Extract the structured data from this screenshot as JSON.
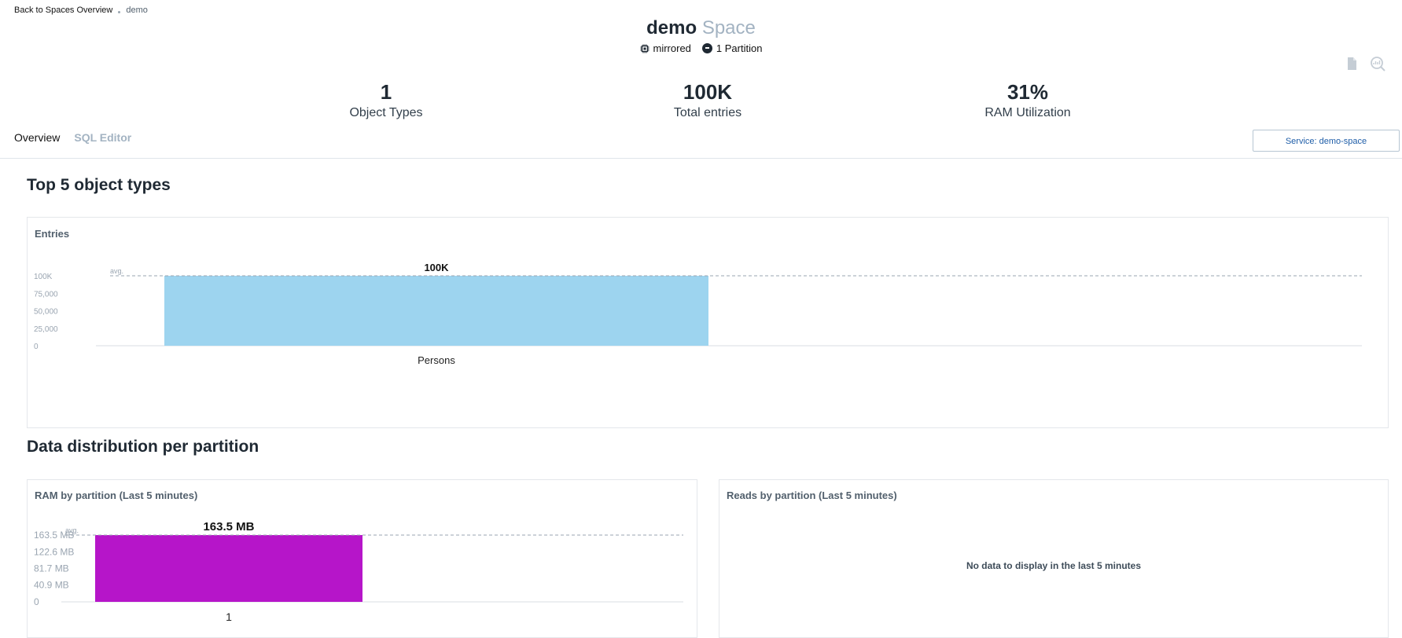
{
  "breadcrumb": {
    "back": "Back to Spaces Overview",
    "current": "demo"
  },
  "header": {
    "space_name": "demo",
    "space_suffix": "Space",
    "badges": {
      "mode": "mirrored",
      "partitions": "1 Partition"
    },
    "icons": [
      "document-icon",
      "monitor-search-icon"
    ]
  },
  "stats": [
    {
      "value": "1",
      "label": "Object Types"
    },
    {
      "value": "100K",
      "label": "Total entries"
    },
    {
      "value": "31%",
      "label": "RAM Utilization"
    }
  ],
  "tabs": [
    {
      "label": "Overview",
      "active": true
    },
    {
      "label": "SQL Editor",
      "active": false
    }
  ],
  "service_button": "Service: demo-space",
  "sections": {
    "top_types": "Top 5 object types",
    "distribution": "Data distribution per partition"
  },
  "panels": {
    "entries_title": "Entries",
    "ram_title": "RAM by partition (Last 5 minutes)",
    "reads_title": "Reads by partition (Last 5 minutes)",
    "reads_empty": "No data to display in the last 5 minutes"
  },
  "chart_data": [
    {
      "type": "bar",
      "title": "Entries",
      "categories": [
        "Persons"
      ],
      "values": [
        100000
      ],
      "data_labels": [
        "100K"
      ],
      "ylim": [
        0,
        100000
      ],
      "yticks": [
        0,
        25000,
        50000,
        75000,
        100000
      ],
      "ytick_labels": [
        "0",
        "25,000",
        "50,000",
        "75,000",
        "100K"
      ],
      "avg_line": {
        "label": "avg.",
        "value": 100000
      },
      "color": "#9dd4ef"
    },
    {
      "type": "bar",
      "title": "RAM by partition (Last 5 minutes)",
      "categories": [
        "1"
      ],
      "values": [
        163.5
      ],
      "data_labels": [
        "163.5 MB"
      ],
      "ylim": [
        0,
        163.5
      ],
      "yticks": [
        0,
        40.9,
        81.7,
        122.6,
        163.5
      ],
      "ytick_labels": [
        "0",
        "40.9 MB",
        "81.7 MB",
        "122.6 MB",
        "163.5 MB"
      ],
      "avg_line": {
        "label": "avg.",
        "value": 163.5
      },
      "unit": "MB",
      "color": "#b615c9"
    }
  ]
}
